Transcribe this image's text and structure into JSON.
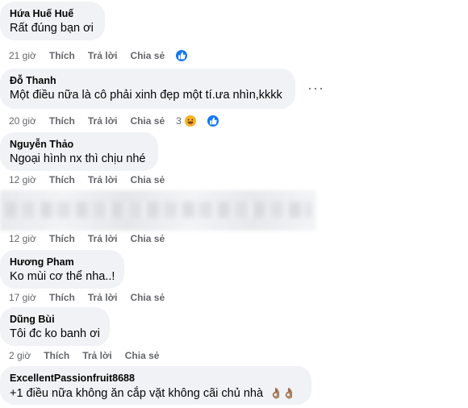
{
  "comments": [
    {
      "author": "Hứa Huế Huế",
      "text": "Rất đúng bạn ơi",
      "time": "21 giờ",
      "reaction_count": ""
    },
    {
      "author": "Đỗ Thanh",
      "text": "Một điều nữa là cô phải xinh đẹp một tí.ưa nhìn,kkkk",
      "time": "20 giờ",
      "reaction_count": "3"
    },
    {
      "author": "Nguyễn Thảo",
      "text": "Ngoại hình nx thì chịu nhé",
      "time": "12 giờ"
    },
    {
      "author": "",
      "text": "",
      "time": "12 giờ",
      "blurred": true
    },
    {
      "author": "Hương Pham",
      "text": "Ko mùi cơ thể nha..!",
      "time": "17 giờ"
    },
    {
      "author": "Dũng Bùi",
      "text": "Tôi đc ko banh ơi",
      "time": "2 giờ"
    },
    {
      "author": "ExcellentPassionfruit8688",
      "text": "+1 điều nữa không ăn cắp vặt không cãi chủ nhà",
      "emoji": "👌🏽👌🏽"
    }
  ],
  "actions": {
    "like": "Thích",
    "reply": "Trả lời",
    "share": "Chia sẻ"
  },
  "more_label": "···",
  "icons": {
    "like": "thumbs-up-icon",
    "haha": "laughing-face-icon",
    "more": "more-options-icon"
  },
  "colors": {
    "bubble": "#f0f2f5",
    "like_blue": "#1877f2",
    "haha_yellow": "#f7b125",
    "meta_gray": "#65676b"
  }
}
